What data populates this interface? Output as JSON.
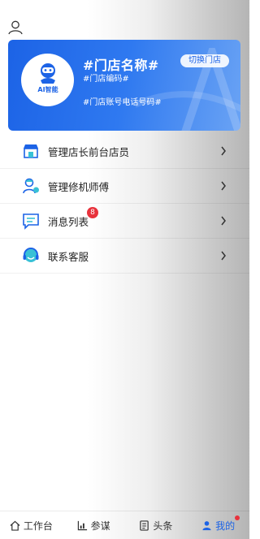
{
  "card": {
    "store_name": "#门店名称#",
    "store_code": "#门店编码#",
    "phone": "#门店账号电话号码#",
    "switch_label": "切换门店",
    "logo_text": "AI智能",
    "logo_icon": "robot-icon"
  },
  "menu": {
    "items": [
      {
        "label": "管理店长前台店员",
        "icon": "store-icon"
      },
      {
        "label": "管理修机师傅",
        "icon": "technician-icon"
      },
      {
        "label": "消息列表",
        "icon": "message-icon",
        "badge": "8"
      },
      {
        "label": "联系客服",
        "icon": "headset-icon"
      }
    ]
  },
  "tabs": [
    {
      "label": "工作台",
      "icon": "home-icon"
    },
    {
      "label": "参谋",
      "icon": "chart-icon"
    },
    {
      "label": "头条",
      "icon": "news-icon"
    },
    {
      "label": "我的",
      "icon": "user-icon",
      "active": true
    }
  ],
  "colors": {
    "accent": "#1c63e6",
    "badge": "#e8323c"
  }
}
